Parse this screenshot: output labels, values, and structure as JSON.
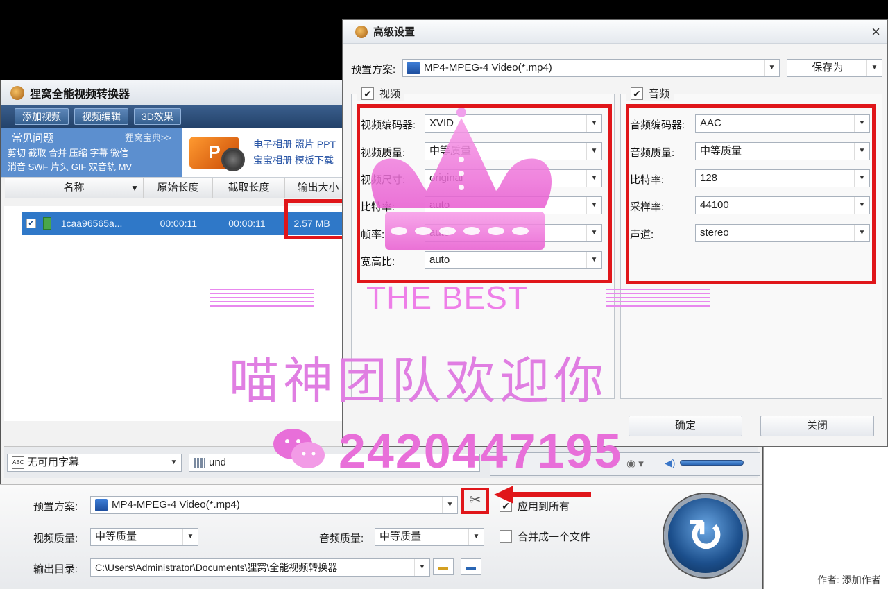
{
  "main": {
    "title": "狸窝全能视频转换器",
    "toolbar": [
      "添加视频",
      "视频编辑",
      "3D效果"
    ],
    "faq": "常见问题",
    "faq_more": "狸窝宝典>>",
    "quick_links_1": "剪切 截取 合并 压缩 字幕 微信",
    "quick_links_2": "消音 SWF 片头 GIF 双音轨 MV",
    "ppt_logo": "P",
    "banner_links_1": "电子相册 照片 PPT",
    "banner_links_2": "宝宝相册 模板下载",
    "columns": [
      "名称",
      "原始长度",
      "截取长度",
      "输出大小"
    ],
    "file": {
      "name": "1caa96565a...",
      "original": "00:00:11",
      "cut": "00:00:11",
      "output": "2.57 MB",
      "checked": "✔"
    },
    "subtitle": "无可用字幕",
    "audio_track": "und",
    "preset_label": "预置方案:",
    "preset_value": "MP4-MPEG-4 Video(*.mp4)",
    "apply_all": "应用到所有",
    "video_quality_label": "视频质量:",
    "video_quality": "中等质量",
    "audio_quality_label": "音频质量:",
    "audio_quality": "中等质量",
    "merge_label": "合并成一个文件",
    "output_dir_label": "输出目录:",
    "output_dir": "C:\\Users\\Administrator\\Documents\\狸窝\\全能视频转换器",
    "author": "作者: 添加作者"
  },
  "dialog": {
    "title": "高级设置",
    "close": "×",
    "preset_label": "预置方案:",
    "preset_value": "MP4-MPEG-4 Video(*.mp4)",
    "save_as": "保存为",
    "video_group": "视频",
    "audio_group": "音频",
    "video_rows": [
      {
        "label": "视频编码器:",
        "value": "XVID"
      },
      {
        "label": "视频质量:",
        "value": "中等质量"
      },
      {
        "label": "视频尺寸:",
        "value": "original"
      },
      {
        "label": "比特率:",
        "value": "auto"
      },
      {
        "label": "帧率:",
        "value": "auto"
      },
      {
        "label": "宽高比:",
        "value": "auto"
      }
    ],
    "audio_rows": [
      {
        "label": "音频编码器:",
        "value": "AAC"
      },
      {
        "label": "音频质量:",
        "value": "中等质量"
      },
      {
        "label": "比特率:",
        "value": "128"
      },
      {
        "label": "采样率:",
        "value": "44100"
      },
      {
        "label": "声道:",
        "value": "stereo"
      }
    ],
    "ok": "确定",
    "cancel": "关闭"
  },
  "watermark": {
    "best": "THE BEST",
    "slogan": "喵神团队欢迎你",
    "number": "2420447195"
  },
  "colors": {
    "highlight_red": "#e0161a",
    "selection_blue": "#2f78c8",
    "watermark_pink": "#e07ee2"
  }
}
